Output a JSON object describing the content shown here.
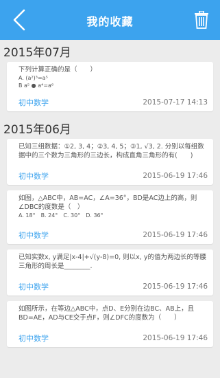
{
  "header": {
    "title": "我的收藏",
    "bg_color": "#3ca3ee",
    "back_icon": "chevron-left-icon",
    "trash_icon": "trash-icon"
  },
  "groups": [
    {
      "month": "2015年07月",
      "items": [
        {
          "question": "下列计算正确的是（　　）",
          "extra": [
            "A. (a²)³=a⁵",
            "B a⁵ ● a⁴=a⁶"
          ],
          "subject": "初中数学",
          "date": "2015-07-17 14:13"
        }
      ]
    },
    {
      "month": "2015年06月",
      "items": [
        {
          "question": "已知三组数据：①2, 3, 4；②3, 4, 5；③1, √3, 2. 分别以每组数据中的三个数为三角形的三边长，构成直角三角形的有(　　)",
          "extra": [],
          "subject": "初中数学",
          "date": "2015-06-19 17:46"
        },
        {
          "question": "如图，△ABC中，AB=AC，∠A=36°，BD是AC边上的高，则∠DBC的度数是（　）",
          "extra": [
            "A. 18°　B. 24°　C. 30°　D. 36°"
          ],
          "subject": "初中数学",
          "date": "2015-06-19 17:46"
        },
        {
          "question": "已知实数x, y满足|x-4|+√(y-8)=0, 则以x, y的值为两边长的等腰三角形的周长是________.",
          "extra": [],
          "subject": "初中数学",
          "date": "2015-06-19 17:46"
        },
        {
          "question": "如图所示，在等边△ABC中，点D、E分别在边BC、AB上，且BD=AE，AD与CE交于点F，则∠DFC的度数为（　　）",
          "extra": [],
          "subject": "初中数学",
          "date": "2015-06-19 17:46"
        }
      ]
    }
  ]
}
